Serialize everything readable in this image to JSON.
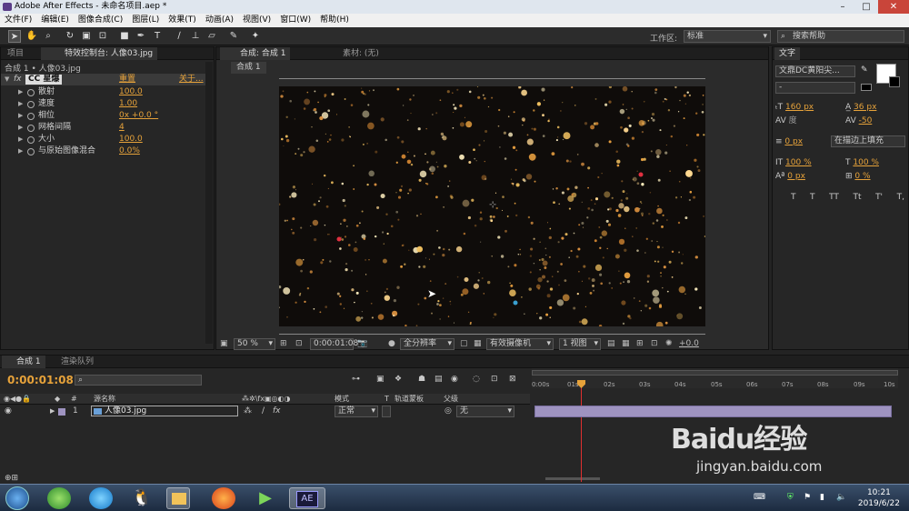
{
  "app": {
    "window_title": "Adobe After Effects - 未命名项目.aep *"
  },
  "menu": [
    "文件(F)",
    "编辑(E)",
    "图像合成(C)",
    "图层(L)",
    "效果(T)",
    "动画(A)",
    "视图(V)",
    "窗口(W)",
    "帮助(H)"
  ],
  "toolbar": {
    "workspace_label": "工作区:",
    "workspace_value": "标准",
    "help_placeholder": "搜索帮助"
  },
  "effects_panel": {
    "tab_project": "项目",
    "tab_effects": "特效控制台: 人像03.jpg",
    "breadcrumb": "合成 1 • 人像03.jpg",
    "fx_label": "fx",
    "effect_name": "CC 星爆",
    "reset": "重置",
    "about": "关于...",
    "properties": [
      {
        "name": "散射",
        "value": "100.0"
      },
      {
        "name": "速度",
        "value": "1.00"
      },
      {
        "name": "相位",
        "value": "0x +0.0 °"
      },
      {
        "name": "网格间隔",
        "value": "4"
      },
      {
        "name": "大小",
        "value": "100.0"
      },
      {
        "name": "与原始图像混合",
        "value": "0.0%"
      }
    ]
  },
  "comp_panel": {
    "tab_comp": "合成: 合成 1",
    "tab_footage": "素材: (无)",
    "subtab": "合成 1",
    "zoom": "50 %",
    "timecode": "0:00:01:08",
    "resolution": "全分辨率",
    "camera": "有效摄像机",
    "views": "1 视图",
    "exposure": "+0.0"
  },
  "char_panel": {
    "title": "文字",
    "font": "文鼎DC黄阳尖...",
    "style": "-",
    "size": "160 px",
    "leading": "36 px",
    "kerning": "度",
    "tracking": "-50",
    "indent": "0 px",
    "stroke_mode": "在描边上填充",
    "vscale": "100 %",
    "hscale": "100 %",
    "baseline": "0 px",
    "tsume": "0 %",
    "styles": [
      "T",
      "T",
      "TT",
      "Tt",
      "T'",
      "T,"
    ]
  },
  "timeline": {
    "tab_comp": "合成 1",
    "tab_render": "渲染队列",
    "timecode": "0:00:01:08",
    "col_source": "源名称",
    "col_mode": "模式",
    "col_t": "T",
    "col_trkmat": "轨道蒙板",
    "col_parent": "父级",
    "layer_num": "1",
    "layer_name": "人像03.jpg",
    "layer_mode": "正常",
    "layer_parent": "无",
    "ruler": [
      "0:00s",
      "01s",
      "02s",
      "03s",
      "04s",
      "05s",
      "06s",
      "07s",
      "08s",
      "09s",
      "10s"
    ],
    "playhead_seconds": 1.33
  },
  "taskbar": {
    "time": "10:21",
    "date": "2019/6/22",
    "ae_label": "AE"
  },
  "watermark": {
    "brand": "Baidu经验",
    "url": "jingyan.baidu.com"
  },
  "colors": {
    "accent_orange": "#e6a23a",
    "playhead": "#e03030",
    "layer_bar": "#9e93c0"
  }
}
